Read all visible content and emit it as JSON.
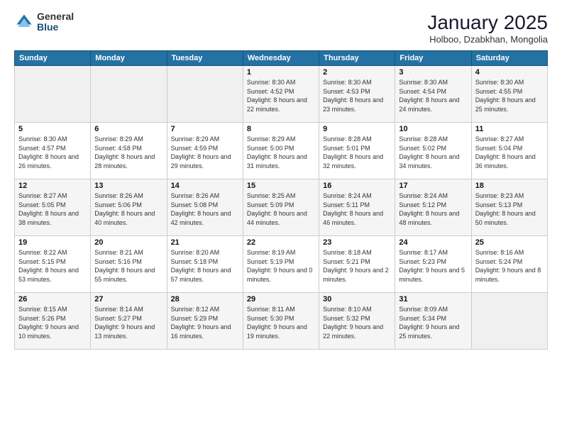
{
  "logo": {
    "general": "General",
    "blue": "Blue"
  },
  "header": {
    "title": "January 2025",
    "subtitle": "Holboo, Dzabkhan, Mongolia"
  },
  "weekdays": [
    "Sunday",
    "Monday",
    "Tuesday",
    "Wednesday",
    "Thursday",
    "Friday",
    "Saturday"
  ],
  "weeks": [
    [
      {
        "day": "",
        "sunrise": "",
        "sunset": "",
        "daylight": ""
      },
      {
        "day": "",
        "sunrise": "",
        "sunset": "",
        "daylight": ""
      },
      {
        "day": "",
        "sunrise": "",
        "sunset": "",
        "daylight": ""
      },
      {
        "day": "1",
        "sunrise": "Sunrise: 8:30 AM",
        "sunset": "Sunset: 4:52 PM",
        "daylight": "Daylight: 8 hours and 22 minutes."
      },
      {
        "day": "2",
        "sunrise": "Sunrise: 8:30 AM",
        "sunset": "Sunset: 4:53 PM",
        "daylight": "Daylight: 8 hours and 23 minutes."
      },
      {
        "day": "3",
        "sunrise": "Sunrise: 8:30 AM",
        "sunset": "Sunset: 4:54 PM",
        "daylight": "Daylight: 8 hours and 24 minutes."
      },
      {
        "day": "4",
        "sunrise": "Sunrise: 8:30 AM",
        "sunset": "Sunset: 4:55 PM",
        "daylight": "Daylight: 8 hours and 25 minutes."
      }
    ],
    [
      {
        "day": "5",
        "sunrise": "Sunrise: 8:30 AM",
        "sunset": "Sunset: 4:57 PM",
        "daylight": "Daylight: 8 hours and 26 minutes."
      },
      {
        "day": "6",
        "sunrise": "Sunrise: 8:29 AM",
        "sunset": "Sunset: 4:58 PM",
        "daylight": "Daylight: 8 hours and 28 minutes."
      },
      {
        "day": "7",
        "sunrise": "Sunrise: 8:29 AM",
        "sunset": "Sunset: 4:59 PM",
        "daylight": "Daylight: 8 hours and 29 minutes."
      },
      {
        "day": "8",
        "sunrise": "Sunrise: 8:29 AM",
        "sunset": "Sunset: 5:00 PM",
        "daylight": "Daylight: 8 hours and 31 minutes."
      },
      {
        "day": "9",
        "sunrise": "Sunrise: 8:28 AM",
        "sunset": "Sunset: 5:01 PM",
        "daylight": "Daylight: 8 hours and 32 minutes."
      },
      {
        "day": "10",
        "sunrise": "Sunrise: 8:28 AM",
        "sunset": "Sunset: 5:02 PM",
        "daylight": "Daylight: 8 hours and 34 minutes."
      },
      {
        "day": "11",
        "sunrise": "Sunrise: 8:27 AM",
        "sunset": "Sunset: 5:04 PM",
        "daylight": "Daylight: 8 hours and 36 minutes."
      }
    ],
    [
      {
        "day": "12",
        "sunrise": "Sunrise: 8:27 AM",
        "sunset": "Sunset: 5:05 PM",
        "daylight": "Daylight: 8 hours and 38 minutes."
      },
      {
        "day": "13",
        "sunrise": "Sunrise: 8:26 AM",
        "sunset": "Sunset: 5:06 PM",
        "daylight": "Daylight: 8 hours and 40 minutes."
      },
      {
        "day": "14",
        "sunrise": "Sunrise: 8:26 AM",
        "sunset": "Sunset: 5:08 PM",
        "daylight": "Daylight: 8 hours and 42 minutes."
      },
      {
        "day": "15",
        "sunrise": "Sunrise: 8:25 AM",
        "sunset": "Sunset: 5:09 PM",
        "daylight": "Daylight: 8 hours and 44 minutes."
      },
      {
        "day": "16",
        "sunrise": "Sunrise: 8:24 AM",
        "sunset": "Sunset: 5:11 PM",
        "daylight": "Daylight: 8 hours and 46 minutes."
      },
      {
        "day": "17",
        "sunrise": "Sunrise: 8:24 AM",
        "sunset": "Sunset: 5:12 PM",
        "daylight": "Daylight: 8 hours and 48 minutes."
      },
      {
        "day": "18",
        "sunrise": "Sunrise: 8:23 AM",
        "sunset": "Sunset: 5:13 PM",
        "daylight": "Daylight: 8 hours and 50 minutes."
      }
    ],
    [
      {
        "day": "19",
        "sunrise": "Sunrise: 8:22 AM",
        "sunset": "Sunset: 5:15 PM",
        "daylight": "Daylight: 8 hours and 53 minutes."
      },
      {
        "day": "20",
        "sunrise": "Sunrise: 8:21 AM",
        "sunset": "Sunset: 5:16 PM",
        "daylight": "Daylight: 8 hours and 55 minutes."
      },
      {
        "day": "21",
        "sunrise": "Sunrise: 8:20 AM",
        "sunset": "Sunset: 5:18 PM",
        "daylight": "Daylight: 8 hours and 57 minutes."
      },
      {
        "day": "22",
        "sunrise": "Sunrise: 8:19 AM",
        "sunset": "Sunset: 5:19 PM",
        "daylight": "Daylight: 9 hours and 0 minutes."
      },
      {
        "day": "23",
        "sunrise": "Sunrise: 8:18 AM",
        "sunset": "Sunset: 5:21 PM",
        "daylight": "Daylight: 9 hours and 2 minutes."
      },
      {
        "day": "24",
        "sunrise": "Sunrise: 8:17 AM",
        "sunset": "Sunset: 5:23 PM",
        "daylight": "Daylight: 9 hours and 5 minutes."
      },
      {
        "day": "25",
        "sunrise": "Sunrise: 8:16 AM",
        "sunset": "Sunset: 5:24 PM",
        "daylight": "Daylight: 9 hours and 8 minutes."
      }
    ],
    [
      {
        "day": "26",
        "sunrise": "Sunrise: 8:15 AM",
        "sunset": "Sunset: 5:26 PM",
        "daylight": "Daylight: 9 hours and 10 minutes."
      },
      {
        "day": "27",
        "sunrise": "Sunrise: 8:14 AM",
        "sunset": "Sunset: 5:27 PM",
        "daylight": "Daylight: 9 hours and 13 minutes."
      },
      {
        "day": "28",
        "sunrise": "Sunrise: 8:12 AM",
        "sunset": "Sunset: 5:29 PM",
        "daylight": "Daylight: 9 hours and 16 minutes."
      },
      {
        "day": "29",
        "sunrise": "Sunrise: 8:11 AM",
        "sunset": "Sunset: 5:30 PM",
        "daylight": "Daylight: 9 hours and 19 minutes."
      },
      {
        "day": "30",
        "sunrise": "Sunrise: 8:10 AM",
        "sunset": "Sunset: 5:32 PM",
        "daylight": "Daylight: 9 hours and 22 minutes."
      },
      {
        "day": "31",
        "sunrise": "Sunrise: 8:09 AM",
        "sunset": "Sunset: 5:34 PM",
        "daylight": "Daylight: 9 hours and 25 minutes."
      },
      {
        "day": "",
        "sunrise": "",
        "sunset": "",
        "daylight": ""
      }
    ]
  ]
}
